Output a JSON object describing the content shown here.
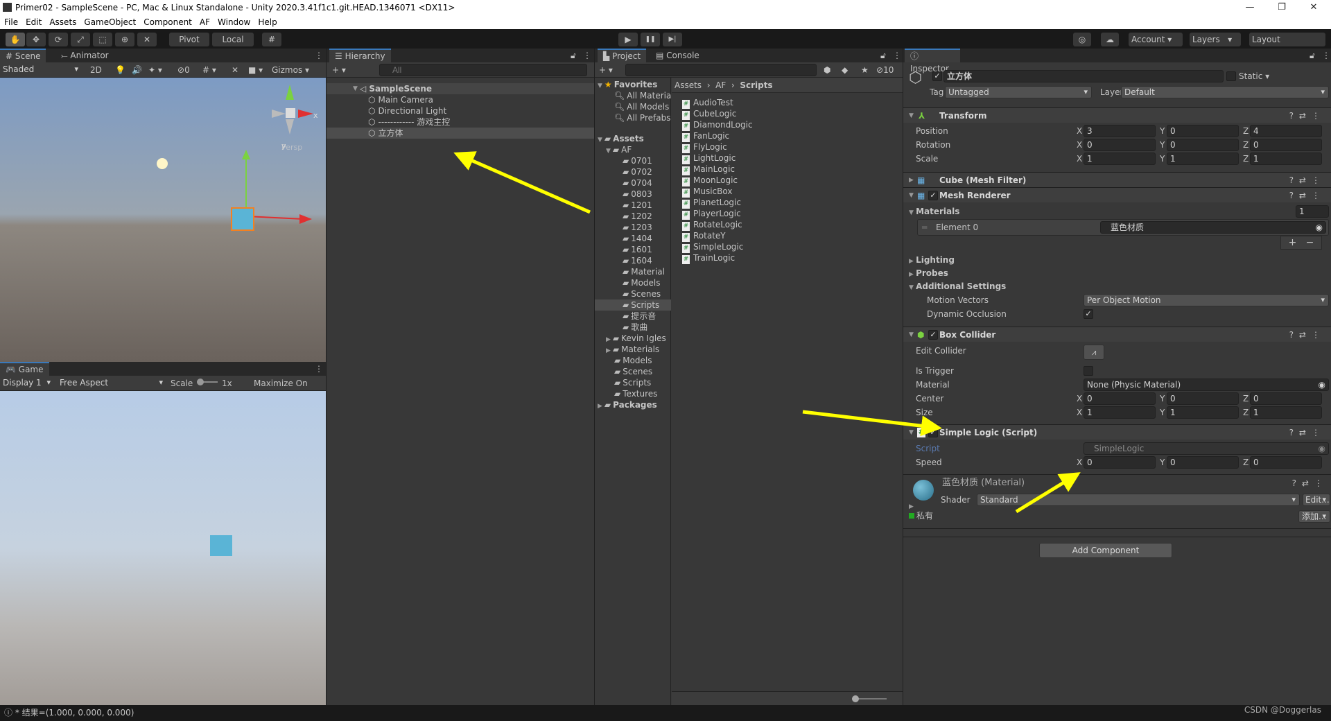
{
  "window": {
    "title": "Primer02 - SampleScene - PC, Mac & Linux Standalone - Unity 2020.3.41f1c1.git.HEAD.1346071 <DX11>",
    "controls": [
      "—",
      "❐",
      "✕"
    ]
  },
  "menu": [
    "File",
    "Edit",
    "Assets",
    "GameObject",
    "Component",
    "AF",
    "Window",
    "Help"
  ],
  "toolbar": {
    "pivot": "Pivot",
    "local": "Local",
    "account": "Account",
    "layers": "Layers",
    "layout": "Layout",
    "play": "▶",
    "pause": "❚❚",
    "step": "▶|"
  },
  "scene": {
    "tab": "Scene",
    "tab2": "Animator",
    "shading": "Shaded",
    "mode_2d": "2D",
    "hidden_count": "0",
    "gizmos": "Gizmos",
    "persp": "Persp",
    "axis_y": "y",
    "axis_x": "x"
  },
  "game": {
    "tab": "Game",
    "display": "Display 1",
    "aspect": "Free Aspect",
    "scale_label": "Scale",
    "scale_value": "1x",
    "maximize": "Maximize On Play"
  },
  "hierarchy": {
    "tab": "Hierarchy",
    "search_placeholder": "All",
    "scene": "SampleScene",
    "items": [
      "Main Camera",
      "Directional Light",
      "------------ 游戏主控",
      "立方体"
    ],
    "selected": "立方体"
  },
  "project": {
    "tab": "Project",
    "tab2": "Console",
    "hidden_count": "10",
    "favorites": {
      "label": "Favorites",
      "items": [
        "All Materia",
        "All Models",
        "All Prefabs"
      ]
    },
    "assets": {
      "label": "Assets",
      "af": "AF",
      "af_children": [
        "0701",
        "0702",
        "0704",
        "0803",
        "1201",
        "1202",
        "1203",
        "1404",
        "1601",
        "1604",
        "Material",
        "Models",
        "Scenes",
        "Scripts",
        "提示音",
        "歌曲"
      ],
      "children": [
        "Kevin Igles",
        "Materials",
        "Models",
        "Scenes",
        "Scripts",
        "Textures"
      ]
    },
    "packages": "Packages",
    "breadcrumb": [
      "Assets",
      "AF",
      "Scripts"
    ],
    "scripts": [
      "AudioTest",
      "CubeLogic",
      "DiamondLogic",
      "FanLogic",
      "FlyLogic",
      "LightLogic",
      "MainLogic",
      "MoonLogic",
      "MusicBox",
      "PlanetLogic",
      "PlayerLogic",
      "RotateLogic",
      "RotateY",
      "SimpleLogic",
      "TrainLogic"
    ],
    "selected_folder": "Scripts"
  },
  "inspector": {
    "tab": "Inspector",
    "object_name": "立方体",
    "active": true,
    "static_label": "Static",
    "tag_label": "Tag",
    "tag": "Untagged",
    "layer_label": "Layer",
    "layer": "Default",
    "transform": {
      "title": "Transform",
      "rows": [
        {
          "label": "Position",
          "x": "3",
          "y": "0",
          "z": "4"
        },
        {
          "label": "Rotation",
          "x": "0",
          "y": "0",
          "z": "0"
        },
        {
          "label": "Scale",
          "x": "1",
          "y": "1",
          "z": "1"
        }
      ]
    },
    "mesh_filter": {
      "title": "Cube (Mesh Filter)"
    },
    "mesh_renderer": {
      "title": "Mesh Renderer",
      "materials_label": "Materials",
      "materials_count": "1",
      "element_label": "Element 0",
      "element_value": "蓝色材质",
      "lighting": "Lighting",
      "probes": "Probes",
      "additional": "Additional Settings",
      "motion_label": "Motion Vectors",
      "motion_value": "Per Object Motion",
      "occlusion_label": "Dynamic Occlusion",
      "occlusion": true
    },
    "box_collider": {
      "title": "Box Collider",
      "edit_label": "Edit Collider",
      "trigger_label": "Is Trigger",
      "is_trigger": false,
      "material_label": "Material",
      "material_value": "None (Physic Material)",
      "center": {
        "label": "Center",
        "x": "0",
        "y": "0",
        "z": "0"
      },
      "size": {
        "label": "Size",
        "x": "1",
        "y": "1",
        "z": "1"
      }
    },
    "simple_logic": {
      "title": "Simple Logic (Script)",
      "script_label": "Script",
      "script_value": "SimpleLogic",
      "speed": {
        "label": "Speed",
        "x": "0",
        "y": "0",
        "z": "0"
      }
    },
    "material": {
      "title": "蓝色材质 (Material)",
      "shader_label": "Shader",
      "shader": "Standard",
      "edit": "Edit...",
      "private": "私有",
      "add": "添加..."
    },
    "add_component": "Add Component"
  },
  "status": {
    "message": "* 结果=(1.000, 0.000, 0.000)",
    "watermark": "CSDN @Doggerlas"
  },
  "colors": {
    "accent": "#3a79bb",
    "arrow": "#ffff00",
    "cube": "#5ab4d6",
    "selected_row": "#4d4d4d"
  }
}
